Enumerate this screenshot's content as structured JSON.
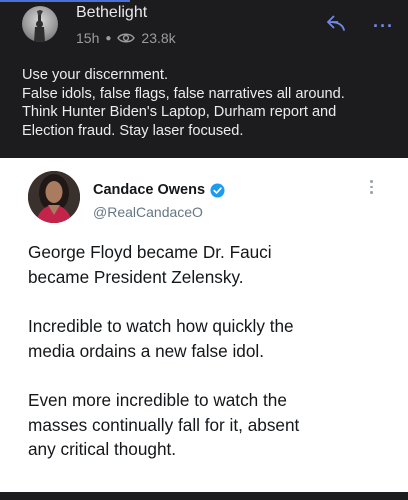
{
  "post": {
    "author": "Bethelight",
    "time": "15h",
    "views": "23.8k",
    "icons": {
      "avatar": "statue-of-liberty-avatar",
      "views": "eye-icon",
      "share": "share-icon",
      "more": "more-icon"
    },
    "text_lines": [
      "Use your discernment.",
      "False idols, false flags, false narratives all around.",
      "Think Hunter Biden's Laptop, Durham report and",
      "Election fraud.  Stay laser focused."
    ]
  },
  "tweet": {
    "name": "Candace Owens",
    "handle": "@RealCandaceO",
    "paragraphs": [
      [
        "George Floyd became Dr. Fauci",
        "became President Zelensky."
      ],
      [
        "Incredible to watch how quickly the",
        "media ordains a new false idol."
      ],
      [
        "Even more incredible to watch the",
        "masses continually fall for it, absent",
        "any critical thought."
      ]
    ]
  },
  "colors": {
    "background": "#1c1c1e",
    "accent": "#6f88e8",
    "verified": "#1d9bf0",
    "tweet_bg": "#ffffff"
  }
}
